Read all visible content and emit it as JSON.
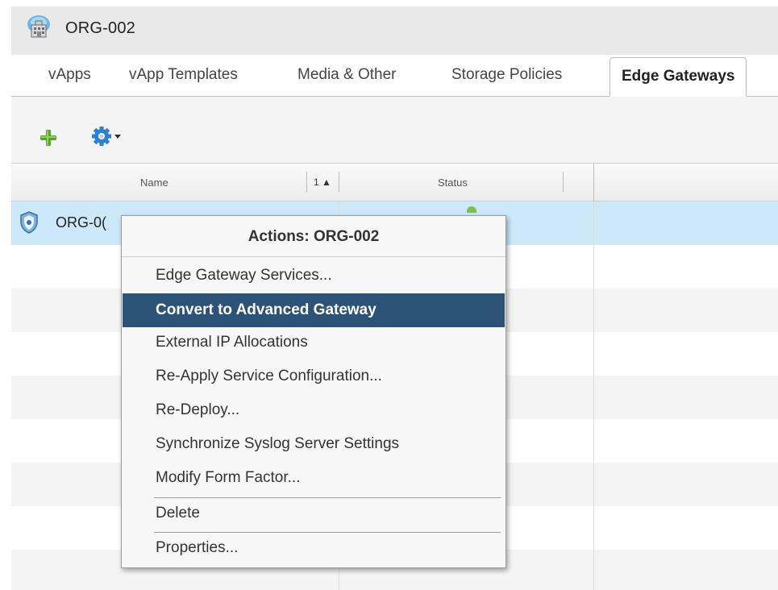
{
  "window": {
    "title": "ORG-002",
    "icon": "organization-building-icon"
  },
  "tabs": [
    {
      "label": "vApps",
      "active": false
    },
    {
      "label": "vApp Templates",
      "active": false
    },
    {
      "label": "Media & Other",
      "active": false
    },
    {
      "label": "Storage Policies",
      "active": false
    },
    {
      "label": "Edge Gateways",
      "active": true
    }
  ],
  "toolbar": {
    "add_icon": "plus-icon",
    "actions_icon": "gear-icon"
  },
  "grid": {
    "columns": [
      {
        "label": "Name",
        "sort": "1 ▲"
      },
      {
        "label": "Status"
      }
    ],
    "rows": [
      {
        "name": "ORG-0(",
        "icon": "edge-gateway-shield-icon",
        "status": "green",
        "selected": true
      }
    ]
  },
  "context_menu": {
    "title": "Actions: ORG-002",
    "items": [
      {
        "label": "Edge Gateway Services..."
      },
      {
        "label": "Convert to Advanced Gateway",
        "highlighted": true
      },
      {
        "label": "External IP Allocations"
      },
      {
        "label": "Re-Apply Service Configuration..."
      },
      {
        "label": "Re-Deploy..."
      },
      {
        "label": "Synchronize Syslog Server Settings"
      },
      {
        "label": "Modify Form Factor..."
      },
      {
        "label": "Delete"
      },
      {
        "label": "Properties..."
      }
    ]
  },
  "colors": {
    "highlight": "#2d5278",
    "selected_row": "#cde8f8",
    "add_green": "#5aa332",
    "gear_blue": "#2f7fd0",
    "status_green": "#7cbf4a"
  }
}
